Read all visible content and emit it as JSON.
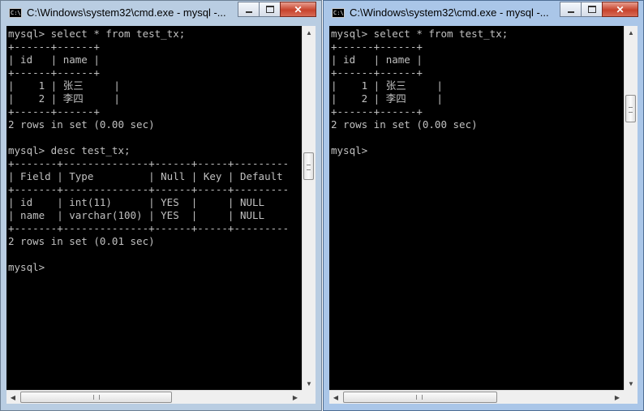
{
  "windows": [
    {
      "title": "C:\\Windows\\system32\\cmd.exe - mysql -...",
      "lines": [
        "mysql> select * from test_tx;",
        "+------+------+",
        "| id   | name |",
        "+------+------+",
        "|    1 | 张三     |",
        "|    2 | 李四     |",
        "+------+------+",
        "2 rows in set (0.00 sec)",
        "",
        "mysql> desc test_tx;",
        "+-------+--------------+------+-----+---------",
        "| Field | Type         | Null | Key | Default",
        "+-------+--------------+------+-----+---------",
        "| id    | int(11)      | YES  |     | NULL",
        "| name  | varchar(100) | YES  |     | NULL",
        "+-------+--------------+------+-----+---------",
        "2 rows in set (0.01 sec)",
        "",
        "mysql>"
      ]
    },
    {
      "title": "C:\\Windows\\system32\\cmd.exe - mysql -...",
      "lines": [
        "mysql> select * from test_tx;",
        "+------+------+",
        "| id   | name |",
        "+------+------+",
        "|    1 | 张三     |",
        "|    2 | 李四     |",
        "+------+------+",
        "2 rows in set (0.00 sec)",
        "",
        "mysql>"
      ]
    }
  ],
  "icons": {
    "app": "cmd-icon",
    "minimize": "minimize-icon",
    "maximize": "maximize-icon",
    "close": "close-icon",
    "scroll_up": "arrow-up-icon",
    "scroll_down": "arrow-down-icon",
    "scroll_left": "arrow-left-icon",
    "scroll_right": "arrow-right-icon"
  },
  "glyphs": {
    "close": "✕",
    "up": "▲",
    "down": "▼",
    "left": "◀",
    "right": "▶",
    "app_icon_text": "C:\\"
  },
  "colors": {
    "console_bg": "#000000",
    "console_fg": "#c0c0c0",
    "close_button": "#c7432c"
  }
}
